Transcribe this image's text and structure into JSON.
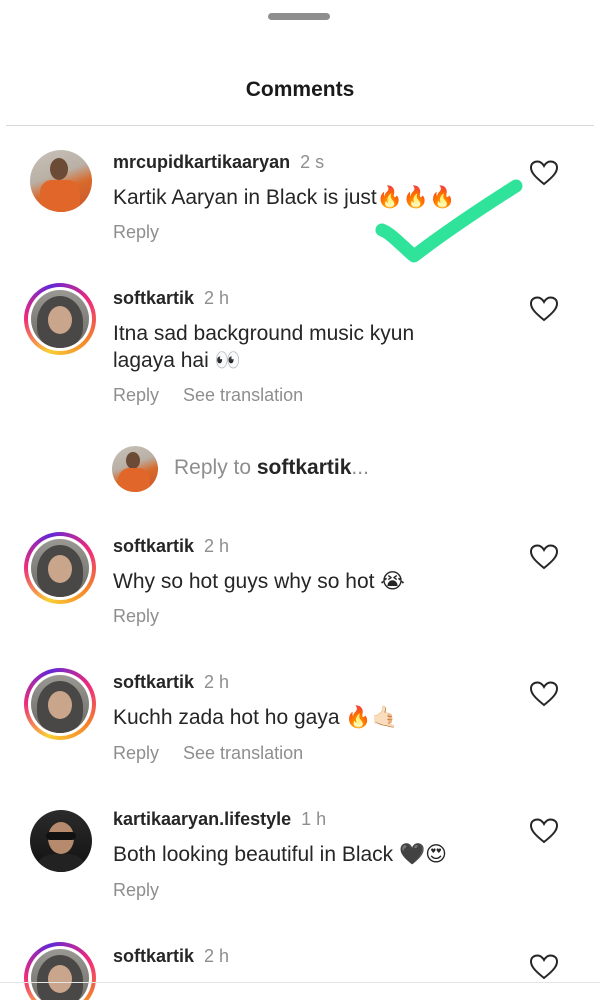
{
  "header": {
    "title": "Comments"
  },
  "comments": [
    {
      "username": "mrcupidkartikaaryan",
      "time": "2 s",
      "text": "Kartik Aaryan in Black is just🔥🔥🔥",
      "reply_label": "Reply",
      "translation_label": ""
    },
    {
      "username": "softkartik",
      "time": "2 h",
      "text": "Itna sad background music kyun lagaya hai 👀",
      "reply_label": "Reply",
      "translation_label": "See translation"
    },
    {
      "username": "softkartik",
      "time": "2 h",
      "text": "Why so hot guys why so hot 😭",
      "reply_label": "Reply",
      "translation_label": ""
    },
    {
      "username": "softkartik",
      "time": "2 h",
      "text": "Kuchh zada hot ho gaya 🔥🤙🏻",
      "reply_label": "Reply",
      "translation_label": "See translation"
    },
    {
      "username": "kartikaaryan.lifestyle",
      "time": "1 h",
      "text": "Both looking beautiful in Black 🖤😍",
      "reply_label": "Reply",
      "translation_label": ""
    },
    {
      "username": "softkartik",
      "time": "2 h",
      "text": "",
      "reply_label": "",
      "translation_label": ""
    }
  ],
  "reply_box": {
    "prefix": "Reply to ",
    "target": "softkartik",
    "suffix": "..."
  },
  "icons": {
    "like": "heart-outline-icon",
    "annotation": "green-checkmark"
  },
  "colors": {
    "checkmark": "#2fe39a",
    "muted_text": "#8e8e8e"
  }
}
